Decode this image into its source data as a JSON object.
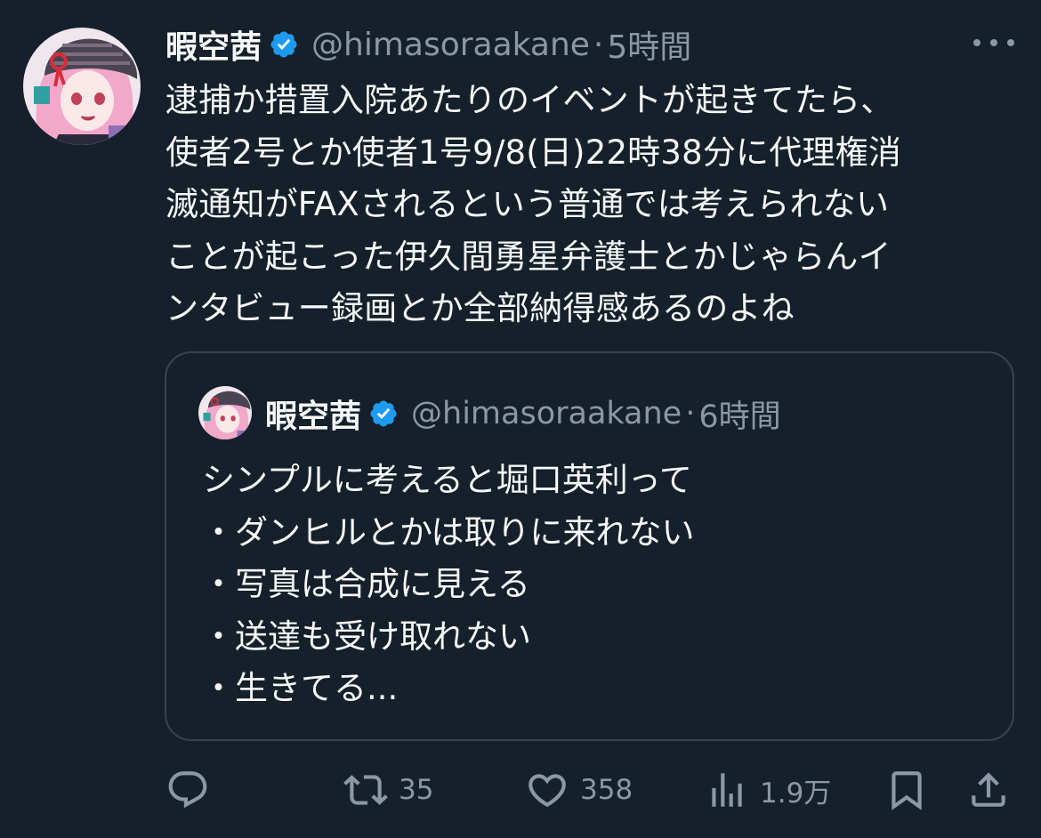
{
  "tweet": {
    "display_name": "暇空茜",
    "handle": "@himasoraakane",
    "separator": "·",
    "time": "5時間",
    "text": "逮捕か措置入院あたりのイベントが起きてたら、\n使者2号とか使者1号9/8(日)22時38分に代理権消\n滅通知がFAXされるという普通では考えられない\nことが起こった伊久間勇星弁護士とかじゃらんイ\nンタビュー録画とか全部納得感あるのよね"
  },
  "quote": {
    "display_name": "暇空茜",
    "handle": "@himasoraakane",
    "separator": "·",
    "time": "6時間",
    "lines": [
      "シンプルに考えると堀口英利って",
      "・ダンヒルとかは取りに来れない",
      "・写真は合成に見える",
      "・送達も受け取れない",
      "・生きてる..."
    ]
  },
  "actions": {
    "reply_count": "",
    "retweet_count": "35",
    "like_count": "358",
    "views_count": "1.9万"
  },
  "colors": {
    "background": "#15202b",
    "text": "#f7f9f9",
    "secondary": "#8b98a5",
    "verified": "#1d9bf0",
    "border": "#38444d"
  },
  "icons": [
    "verified-badge-icon",
    "more-icon",
    "reply-icon",
    "retweet-icon",
    "like-icon",
    "views-icon",
    "bookmark-icon",
    "share-icon"
  ]
}
